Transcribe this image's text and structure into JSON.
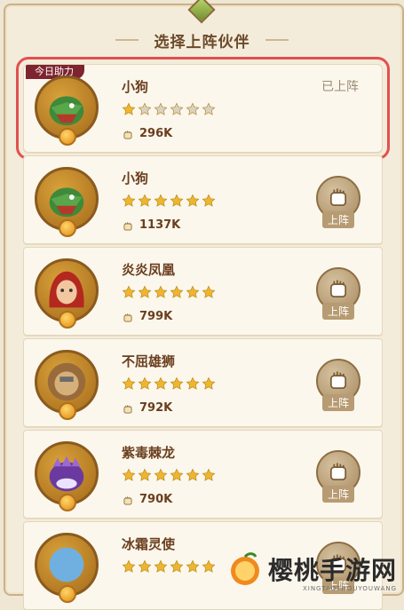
{
  "header": {
    "title": "选择上阵伙伴"
  },
  "cards": [
    {
      "ribbon": "今日助力",
      "name": "小狗",
      "stars_filled": 1,
      "stars_total": 6,
      "power": "296K",
      "status": "已上阵",
      "action": "",
      "avatar": "dragon-green-icon"
    },
    {
      "ribbon": "",
      "name": "小狗",
      "stars_filled": 6,
      "stars_total": 6,
      "power": "1137K",
      "status": "",
      "action": "上阵",
      "avatar": "dragon-green-icon"
    },
    {
      "ribbon": "",
      "name": "炎炎凤凰",
      "stars_filled": 6,
      "stars_total": 6,
      "power": "799K",
      "status": "",
      "action": "上阵",
      "avatar": "phoenix-girl-icon"
    },
    {
      "ribbon": "",
      "name": "不屈雄狮",
      "stars_filled": 6,
      "stars_total": 6,
      "power": "792K",
      "status": "",
      "action": "上阵",
      "avatar": "lion-icon"
    },
    {
      "ribbon": "",
      "name": "紫毒棘龙",
      "stars_filled": 6,
      "stars_total": 6,
      "power": "790K",
      "status": "",
      "action": "上阵",
      "avatar": "dragon-purple-icon"
    },
    {
      "ribbon": "",
      "name": "冰霜灵使",
      "stars_filled": 6,
      "stars_total": 6,
      "power": "",
      "status": "",
      "action": "上阵",
      "avatar": "frost-icon"
    }
  ],
  "watermark": {
    "text": "樱桃手游网",
    "sub": "XINGTAOSHOUYOUWANG"
  },
  "colors": {
    "highlight": "#e25050",
    "ribbon": "#7d2430",
    "star": "#f0b52a",
    "star_empty": "#d9d2c4"
  }
}
